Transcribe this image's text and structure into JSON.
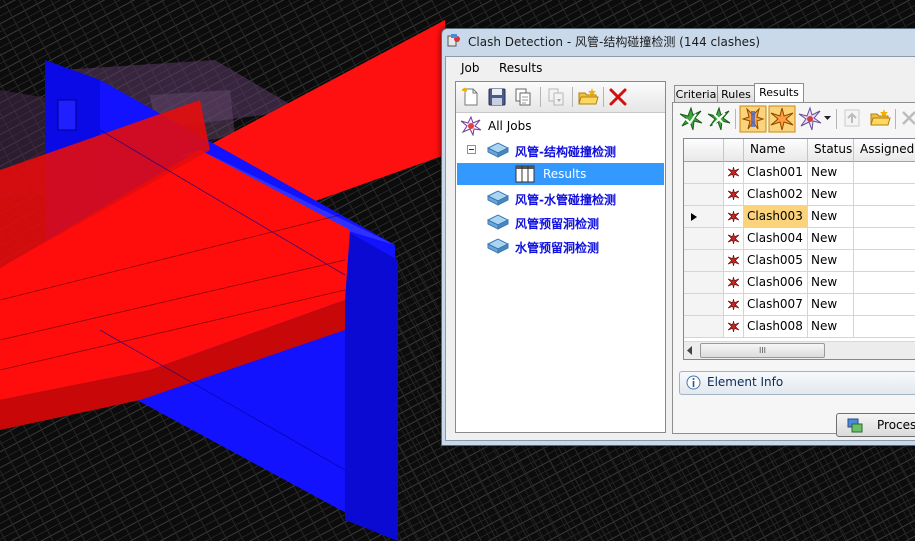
{
  "window": {
    "title": "Clash Detection - 风管-结构碰撞检测 (144 clashes)",
    "title_icon": "clash-detection-app-icon"
  },
  "menu": [
    "Job",
    "Results"
  ],
  "left_toolbar": {
    "icons": [
      "new-job-icon",
      "save-icon",
      "copy-icon",
      "import-icon",
      "open-folder-icon",
      "delete-icon"
    ]
  },
  "tree": {
    "root": "All Jobs",
    "items": [
      {
        "label": "风管-结构碰撞检测",
        "expanded": true,
        "children": [
          "Results"
        ]
      },
      {
        "label": "风管-水管碰撞检测"
      },
      {
        "label": "风管预留洞检测"
      },
      {
        "label": "水管预留洞检测"
      }
    ],
    "selected": "Results"
  },
  "tabs": [
    "Criteria",
    "Rules",
    "Results"
  ],
  "active_tab": "Results",
  "right_toolbar": {
    "icons": [
      "approve-clash-icon",
      "approve-all-icon",
      "highlight-clash-icon",
      "clash-filter-icon",
      "dropdown-arrow-icon",
      "export-up-icon",
      "open-folder-icon",
      "close-icon"
    ]
  },
  "grid": {
    "columns": [
      "Name",
      "Status",
      "Assigned To"
    ],
    "rows": [
      {
        "name": "Clash001",
        "status": "New"
      },
      {
        "name": "Clash002",
        "status": "New"
      },
      {
        "name": "Clash003",
        "status": "New",
        "current": true
      },
      {
        "name": "Clash004",
        "status": "New"
      },
      {
        "name": "Clash005",
        "status": "New"
      },
      {
        "name": "Clash006",
        "status": "New"
      },
      {
        "name": "Clash007",
        "status": "New"
      },
      {
        "name": "Clash008",
        "status": "New"
      }
    ],
    "scroll_thumb_label": "III"
  },
  "element_info": {
    "label": "Element Info",
    "icon": "info-icon"
  },
  "process_button": {
    "label": "Process"
  },
  "colors": {
    "structure_blue": "#0a0aff",
    "duct_red": "#ff0d0d",
    "background": "#0c0c0c",
    "selection": "#3399ff",
    "job_text": "#1010e0",
    "current_cell": "#fbd37a"
  }
}
